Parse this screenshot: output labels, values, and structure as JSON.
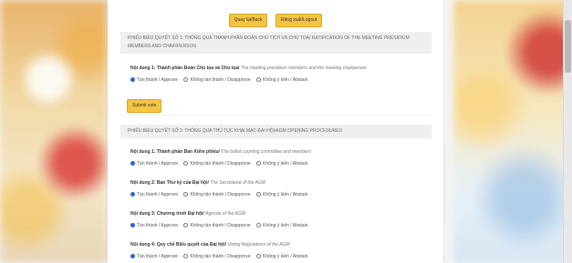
{
  "top_actions": {
    "back": "Quay lại/Back",
    "logout": "Đăng xuất/Logout"
  },
  "section1": {
    "title": "PHIẾU BIỂU QUYẾT SỐ 1: THÔNG QUA THÀNH PHẦN ĐOÀN CHỦ TỊCH VÀ CHỦ TỌA/ RATIFICATION OF THE MEETING PRESIDIUM MEMBERS AND CHAIRPERSON",
    "item1": {
      "label": "Nội dung 1: Thành phần Đoàn Chủ tọa và Chủ tọa/",
      "label_en": "The meeting presidium members and the meeting chairperson"
    },
    "submit": "Submit vote"
  },
  "section2": {
    "title": "PHIẾU BIỂU QUYẾT SỐ 2: THÔNG QUA THỦ TỤC KHAI MẠC ĐẠI HỘI/AGM OPENING PROCEDURES",
    "items": [
      {
        "label": "Nội dung 1: Thành phần Ban Kiểm phiếu/",
        "label_en": "The ballot counting committee and members"
      },
      {
        "label": "Nội dung 2: Ban Thư ký của Đại hội/",
        "label_en": "The Secretariat of the AGM"
      },
      {
        "label": "Nội dung 3: Chương trình Đại hội/",
        "label_en": "Agenda of the AGM"
      },
      {
        "label": "Nội dung 4: Quy chế Biểu quyết của Đại hội/",
        "label_en": "Voting Regulations of the AGM"
      }
    ]
  },
  "options": {
    "approve": "Tán thành / Approve",
    "disapprove": "Không tán thành / Disapprove",
    "abstain": "Không ý kiến / Abstain"
  },
  "colors": {
    "button": "#f5c542",
    "radio_selected": "#2a67c7",
    "section_bg": "#efefef"
  }
}
